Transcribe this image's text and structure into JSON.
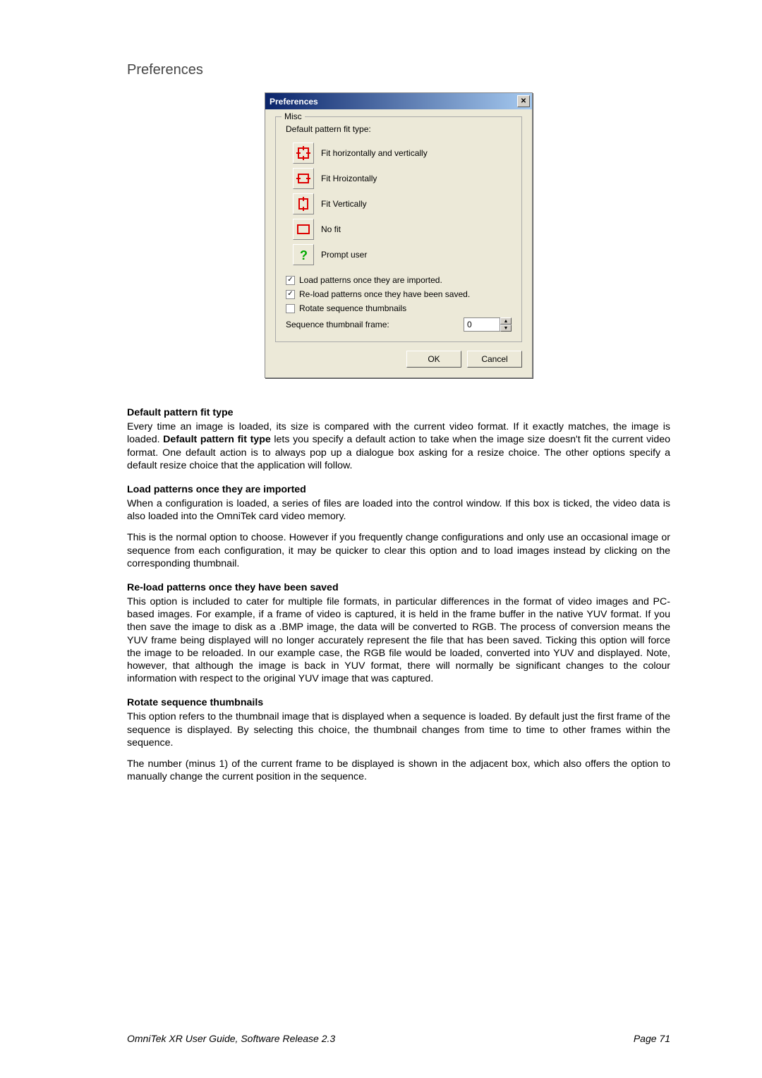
{
  "page_title": "Preferences",
  "dialog": {
    "title": "Preferences",
    "group_legend": "Misc",
    "default_label": "Default pattern fit type:",
    "fit_options": {
      "both": "Fit horizontally and vertically",
      "h": "Fit Hroizontally",
      "v": "Fit Vertically",
      "none": "No fit",
      "prompt": "Prompt user"
    },
    "checks": {
      "load": "Load patterns once they are imported.",
      "reload": "Re-load patterns once they have been saved.",
      "rotate": "Rotate sequence thumbnails"
    },
    "seq_label": "Sequence thumbnail frame:",
    "seq_value": "0",
    "ok": "OK",
    "cancel": "Cancel"
  },
  "sections": {
    "s1_h": "Default pattern fit type",
    "s1_p1a": "Every time an image is loaded, its size is compared with the current video format. If it exactly matches, the image is loaded. ",
    "s1_p1_bold": "Default pattern fit type",
    "s1_p1b": " lets you specify a default action to take when the image size doesn't fit the current video format. One default action is to always pop up a dialogue box asking for a resize choice. The other options specify a default resize choice that the application will follow.",
    "s2_h": "Load patterns once they are imported",
    "s2_p1": "When a configuration is loaded, a series of files are loaded into the control window. If this box is ticked, the video data is also loaded into the OmniTek card video memory.",
    "s2_p2": "This is the normal option to choose. However if you frequently change configurations and only use an occasional image or sequence from each configuration, it may be quicker to clear this option and to load images instead by clicking on the corresponding thumbnail.",
    "s3_h": "Re-load patterns once they have been saved",
    "s3_p1": "This option is included to cater for multiple file formats, in particular differences in the format of video images and PC-based images. For example, if a frame of video is captured, it is held in the frame buffer in the native YUV format. If you then save the image to disk as a .BMP image, the data will be converted to RGB. The process of conversion means the YUV frame being displayed will no longer accurately represent the file that has been saved. Ticking this option will force the image to be reloaded. In our example case, the RGB file would be loaded, converted into YUV and displayed. Note, however, that although the image is back in YUV format, there will normally be significant changes to the colour information with respect to the original YUV image that was captured.",
    "s4_h": "Rotate sequence thumbnails",
    "s4_p1": "This option refers to the thumbnail image that is displayed when a sequence is loaded. By default just the first frame of the sequence is displayed. By selecting this choice, the thumbnail changes from time to time to other frames within the sequence.",
    "s4_p2": "The number (minus 1) of the current frame to be displayed is shown in the adjacent box, which also offers the option to manually change the current position in the sequence."
  },
  "footer": {
    "left": "OmniTek XR User Guide, Software Release 2.3",
    "right": "Page 71"
  }
}
